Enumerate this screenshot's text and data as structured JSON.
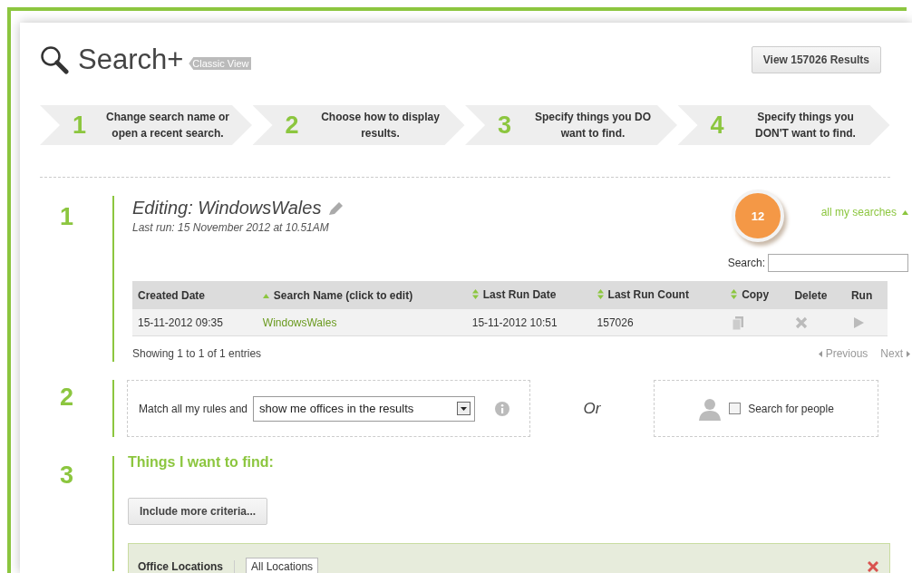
{
  "header": {
    "title": "Search+",
    "view_tag": "Classic View",
    "results_button": "View 157026 Results"
  },
  "steps": [
    {
      "number": "1",
      "text": "Change search name or open a recent search."
    },
    {
      "number": "2",
      "text": "Choose how to display results."
    },
    {
      "number": "3",
      "text": "Specify things you DO want to find."
    },
    {
      "number": "4",
      "text": "Specify things you DON'T want to find."
    }
  ],
  "section_1": {
    "number": "1",
    "title": "Editing: WindowsWales",
    "last_run": "Last run: 15 November 2012 at 10.51AM",
    "badge": "12",
    "searches_link": "all my searches",
    "search_label": "Search:",
    "table": {
      "columns": [
        {
          "label": "Created Date",
          "sortable": false,
          "sorted": false
        },
        {
          "label": "Search Name (click to edit)",
          "sorted": true
        },
        {
          "label": "Last Run Date",
          "sortable": true,
          "sorted": false
        },
        {
          "label": "Last Run Count",
          "sortable": true,
          "sorted": false
        },
        {
          "label": "Copy",
          "sortable": true,
          "sorted": false
        },
        {
          "label": "Delete",
          "sortable": false,
          "sorted": false
        },
        {
          "label": "Run",
          "sortable": false,
          "sorted": false
        }
      ],
      "rows": [
        {
          "created": "15-11-2012 09:35",
          "name": "WindowsWales",
          "last_run_date": "15-11-2012 10:51",
          "last_run_count": "157026"
        }
      ]
    },
    "info": "Showing 1 to 1 of 1 entries",
    "previous": "Previous",
    "next": "Next"
  },
  "section_2": {
    "number": "2",
    "match_label": "Match all my rules and",
    "display_select": "show me offices in the results",
    "or_label": "Or",
    "people_checkbox": {
      "label": "Search for people",
      "checked": false
    }
  },
  "section_3": {
    "number": "3",
    "heading": "Things I want to find:",
    "more_button": "Include more criteria...",
    "criteria": [
      {
        "label": "Office Locations",
        "value": "All Locations"
      }
    ]
  }
}
